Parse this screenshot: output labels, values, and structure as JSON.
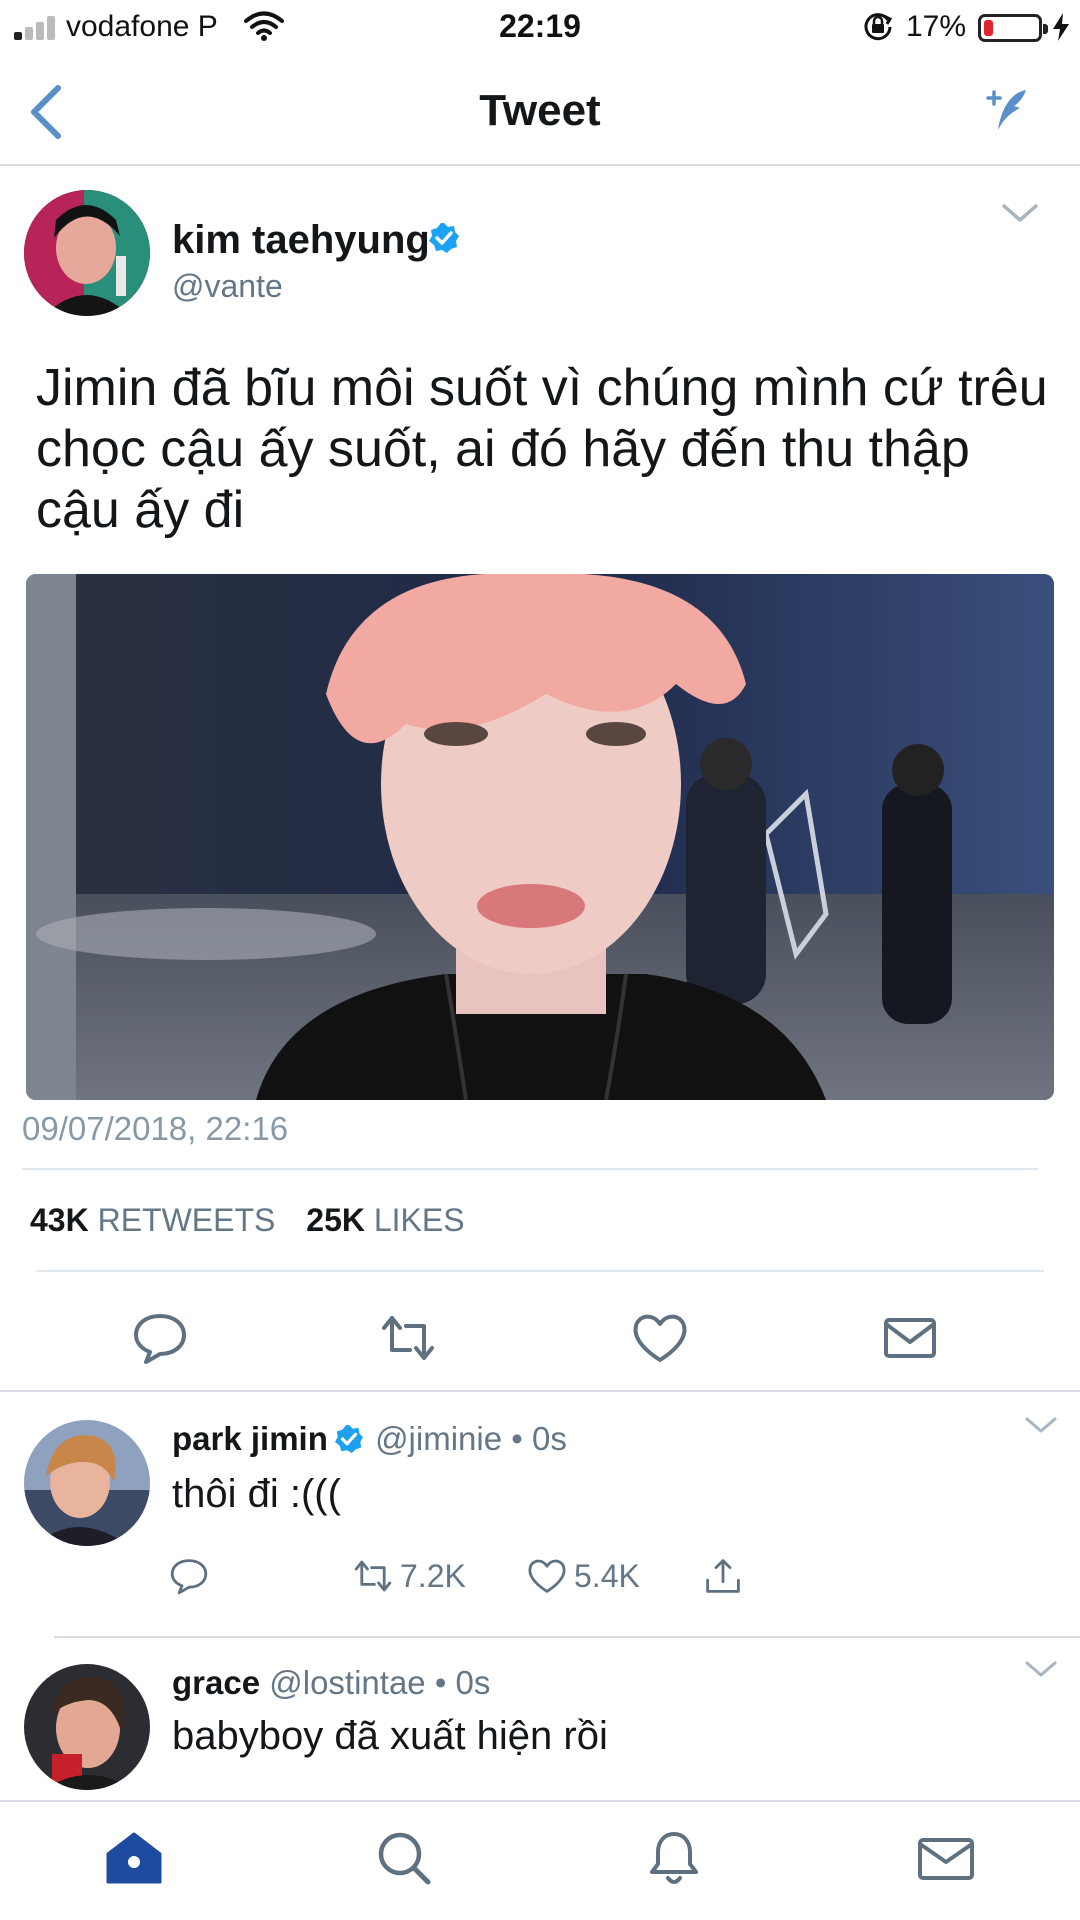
{
  "status_bar": {
    "carrier": "vodafone P",
    "time": "22:19",
    "battery_percent_text": "17%",
    "battery_level": 0.17,
    "battery_color": "#e0242d"
  },
  "nav": {
    "title": "Tweet",
    "back_icon": "chevron-left-icon",
    "compose_icon": "compose-tweet-icon"
  },
  "colors": {
    "accent": "#1da1f2",
    "icon_blue": "#5a8fc9",
    "secondary_text": "#657786"
  },
  "tweet": {
    "author_name": "kim taehyung",
    "verified": true,
    "handle": "@vante",
    "text": "Jimin đã bĩu môi suốt vì chúng mình cứ trêu chọc cậu ấy suốt, ai đó hãy đến thu thập cậu ấy đi",
    "timestamp": "09/07/2018, 22:16",
    "retweets_count": "43K",
    "retweets_label": "RETWEETS",
    "likes_count": "25K",
    "likes_label": "LIKES",
    "actions": [
      "reply-icon",
      "retweet-icon",
      "like-icon",
      "direct-message-icon"
    ]
  },
  "replies": [
    {
      "name": "park jimin",
      "verified": true,
      "handle": "@jiminie",
      "time": "• 0s",
      "text": "thôi đi :(((",
      "retweets": "7.2K",
      "likes": "5.4K"
    },
    {
      "name": "grace",
      "verified": false,
      "handle": "@lostintae",
      "time": "• 0s",
      "text": "babyboy đã xuất hiện rồi"
    }
  ],
  "tab_bar": {
    "items": [
      "home-icon",
      "search-icon",
      "notifications-icon",
      "messages-icon"
    ],
    "active": "home-icon"
  }
}
